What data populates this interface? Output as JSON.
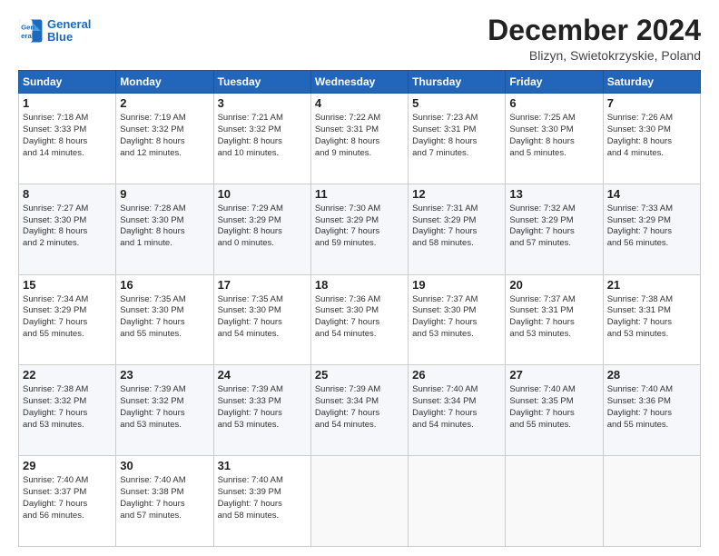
{
  "header": {
    "logo_line1": "General",
    "logo_line2": "Blue",
    "title": "December 2024",
    "subtitle": "Blizyn, Swietokrzyskie, Poland"
  },
  "columns": [
    "Sunday",
    "Monday",
    "Tuesday",
    "Wednesday",
    "Thursday",
    "Friday",
    "Saturday"
  ],
  "weeks": [
    [
      {
        "day": "1",
        "info": "Sunrise: 7:18 AM\nSunset: 3:33 PM\nDaylight: 8 hours\nand 14 minutes."
      },
      {
        "day": "2",
        "info": "Sunrise: 7:19 AM\nSunset: 3:32 PM\nDaylight: 8 hours\nand 12 minutes."
      },
      {
        "day": "3",
        "info": "Sunrise: 7:21 AM\nSunset: 3:32 PM\nDaylight: 8 hours\nand 10 minutes."
      },
      {
        "day": "4",
        "info": "Sunrise: 7:22 AM\nSunset: 3:31 PM\nDaylight: 8 hours\nand 9 minutes."
      },
      {
        "day": "5",
        "info": "Sunrise: 7:23 AM\nSunset: 3:31 PM\nDaylight: 8 hours\nand 7 minutes."
      },
      {
        "day": "6",
        "info": "Sunrise: 7:25 AM\nSunset: 3:30 PM\nDaylight: 8 hours\nand 5 minutes."
      },
      {
        "day": "7",
        "info": "Sunrise: 7:26 AM\nSunset: 3:30 PM\nDaylight: 8 hours\nand 4 minutes."
      }
    ],
    [
      {
        "day": "8",
        "info": "Sunrise: 7:27 AM\nSunset: 3:30 PM\nDaylight: 8 hours\nand 2 minutes."
      },
      {
        "day": "9",
        "info": "Sunrise: 7:28 AM\nSunset: 3:30 PM\nDaylight: 8 hours\nand 1 minute."
      },
      {
        "day": "10",
        "info": "Sunrise: 7:29 AM\nSunset: 3:29 PM\nDaylight: 8 hours\nand 0 minutes."
      },
      {
        "day": "11",
        "info": "Sunrise: 7:30 AM\nSunset: 3:29 PM\nDaylight: 7 hours\nand 59 minutes."
      },
      {
        "day": "12",
        "info": "Sunrise: 7:31 AM\nSunset: 3:29 PM\nDaylight: 7 hours\nand 58 minutes."
      },
      {
        "day": "13",
        "info": "Sunrise: 7:32 AM\nSunset: 3:29 PM\nDaylight: 7 hours\nand 57 minutes."
      },
      {
        "day": "14",
        "info": "Sunrise: 7:33 AM\nSunset: 3:29 PM\nDaylight: 7 hours\nand 56 minutes."
      }
    ],
    [
      {
        "day": "15",
        "info": "Sunrise: 7:34 AM\nSunset: 3:29 PM\nDaylight: 7 hours\nand 55 minutes."
      },
      {
        "day": "16",
        "info": "Sunrise: 7:35 AM\nSunset: 3:30 PM\nDaylight: 7 hours\nand 55 minutes."
      },
      {
        "day": "17",
        "info": "Sunrise: 7:35 AM\nSunset: 3:30 PM\nDaylight: 7 hours\nand 54 minutes."
      },
      {
        "day": "18",
        "info": "Sunrise: 7:36 AM\nSunset: 3:30 PM\nDaylight: 7 hours\nand 54 minutes."
      },
      {
        "day": "19",
        "info": "Sunrise: 7:37 AM\nSunset: 3:30 PM\nDaylight: 7 hours\nand 53 minutes."
      },
      {
        "day": "20",
        "info": "Sunrise: 7:37 AM\nSunset: 3:31 PM\nDaylight: 7 hours\nand 53 minutes."
      },
      {
        "day": "21",
        "info": "Sunrise: 7:38 AM\nSunset: 3:31 PM\nDaylight: 7 hours\nand 53 minutes."
      }
    ],
    [
      {
        "day": "22",
        "info": "Sunrise: 7:38 AM\nSunset: 3:32 PM\nDaylight: 7 hours\nand 53 minutes."
      },
      {
        "day": "23",
        "info": "Sunrise: 7:39 AM\nSunset: 3:32 PM\nDaylight: 7 hours\nand 53 minutes."
      },
      {
        "day": "24",
        "info": "Sunrise: 7:39 AM\nSunset: 3:33 PM\nDaylight: 7 hours\nand 53 minutes."
      },
      {
        "day": "25",
        "info": "Sunrise: 7:39 AM\nSunset: 3:34 PM\nDaylight: 7 hours\nand 54 minutes."
      },
      {
        "day": "26",
        "info": "Sunrise: 7:40 AM\nSunset: 3:34 PM\nDaylight: 7 hours\nand 54 minutes."
      },
      {
        "day": "27",
        "info": "Sunrise: 7:40 AM\nSunset: 3:35 PM\nDaylight: 7 hours\nand 55 minutes."
      },
      {
        "day": "28",
        "info": "Sunrise: 7:40 AM\nSunset: 3:36 PM\nDaylight: 7 hours\nand 55 minutes."
      }
    ],
    [
      {
        "day": "29",
        "info": "Sunrise: 7:40 AM\nSunset: 3:37 PM\nDaylight: 7 hours\nand 56 minutes."
      },
      {
        "day": "30",
        "info": "Sunrise: 7:40 AM\nSunset: 3:38 PM\nDaylight: 7 hours\nand 57 minutes."
      },
      {
        "day": "31",
        "info": "Sunrise: 7:40 AM\nSunset: 3:39 PM\nDaylight: 7 hours\nand 58 minutes."
      },
      {
        "day": "",
        "info": ""
      },
      {
        "day": "",
        "info": ""
      },
      {
        "day": "",
        "info": ""
      },
      {
        "day": "",
        "info": ""
      }
    ]
  ]
}
